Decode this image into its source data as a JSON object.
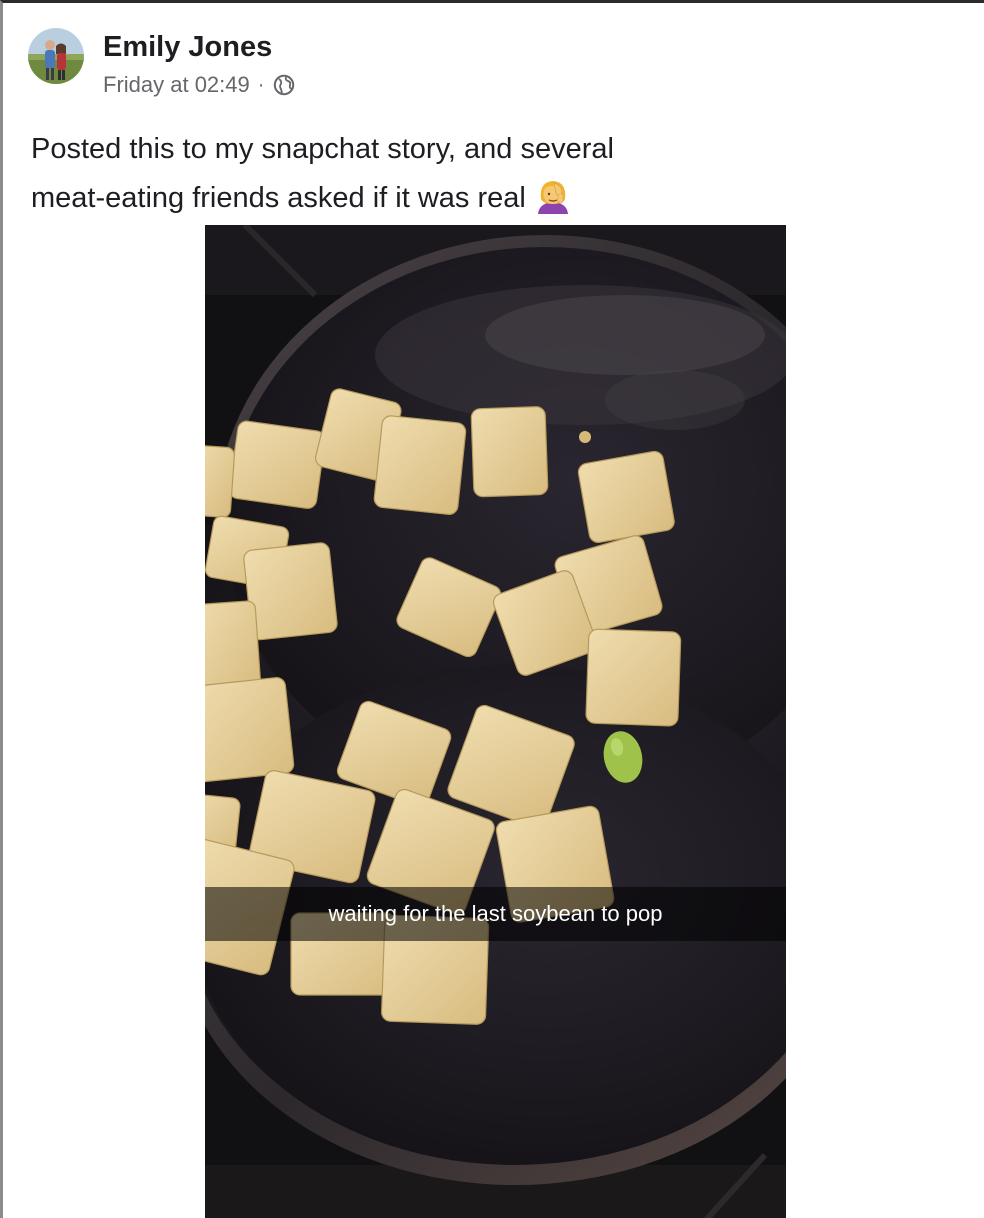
{
  "post": {
    "author_name": "Emily Jones",
    "timestamp": "Friday at 02:49",
    "separator": "·",
    "privacy_icon": "globe-icon",
    "text_line_1": "Posted this to my snapchat story, and several",
    "text_line_2": "meat-eating friends asked if it was real",
    "text_emoji": "woman-facepalming-emoji"
  },
  "photo": {
    "caption": "waiting for the last soybean to pop"
  },
  "colors": {
    "name_text": "#1c1e21",
    "meta_text": "#65676b",
    "tofu": "#e2c88c",
    "pan": "#1e1b22",
    "soybean": "#9ec24a"
  }
}
